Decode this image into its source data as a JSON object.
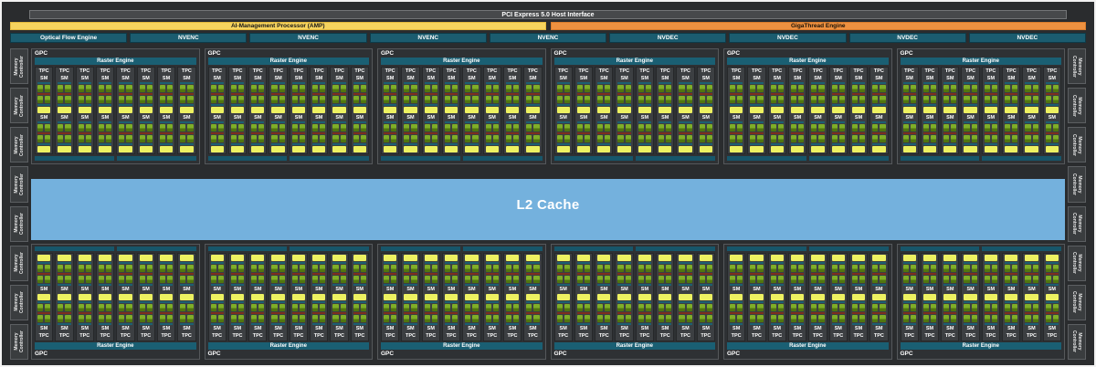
{
  "top_bars": {
    "pci": "PCI Express 5.0 Host Interface",
    "amp": "AI-Management Processor (AMP)",
    "gigathread": "GigaThread Engine"
  },
  "media_engines": [
    "Optical Flow Engine",
    "NVENC",
    "NVENC",
    "NVENC",
    "NVENC",
    "NVDEC",
    "NVDEC",
    "NVDEC",
    "NVDEC"
  ],
  "memory_controllers": {
    "label_lines": [
      "Memory",
      "Controller"
    ],
    "left_count": 8,
    "right_count": 8
  },
  "l2_cache": {
    "label": "L2 Cache"
  },
  "gpc_grid": {
    "gpc_label": "GPC",
    "raster_label": "Raster Engine",
    "tpc_label": "TPC",
    "sm_label": "SM",
    "top_gpcs": 6,
    "bottom_gpcs": 6,
    "tpcs_per_gpc": 8,
    "sms_per_tpc": 2,
    "rops_per_gpc": 2
  },
  "colors": {
    "background": "#2a2c2e",
    "engine_teal": "#1b5c6f",
    "raster_teal": "#1a5f73",
    "amp_yellow": "#f6d45e",
    "gigathread_orange": "#ee9140",
    "l2_blue": "#74b1dd",
    "sm_core_green": "#7fae28",
    "sm_core_green_dark": "#51760f",
    "sm_yellow": "#edf161",
    "red_divider": "#7e2e1e"
  }
}
